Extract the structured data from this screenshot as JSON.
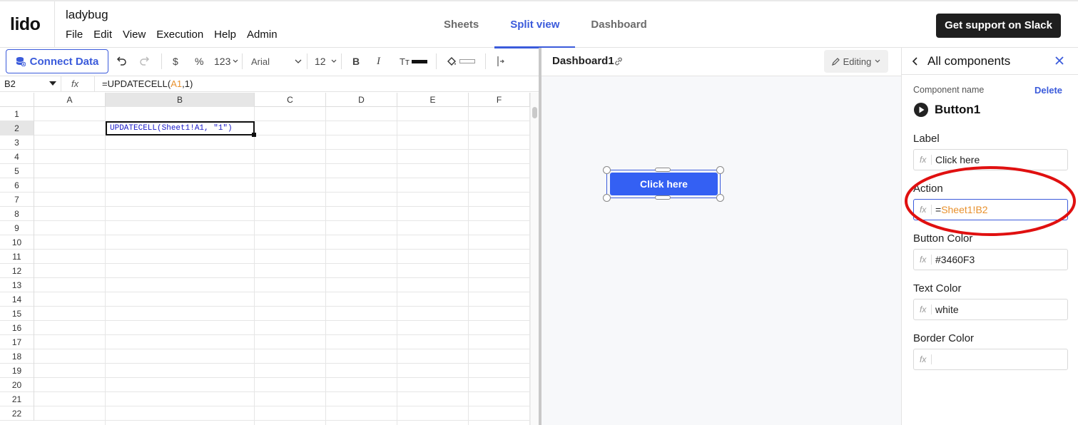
{
  "app": {
    "logo": "lido",
    "doc_title": "ladybug",
    "menu": [
      "File",
      "Edit",
      "View",
      "Execution",
      "Help",
      "Admin"
    ],
    "tabs": [
      {
        "label": "Sheets",
        "active": false
      },
      {
        "label": "Split view",
        "active": true
      },
      {
        "label": "Dashboard",
        "active": false
      }
    ],
    "support_button": "Get support on Slack"
  },
  "toolbar": {
    "connect_data": "Connect Data",
    "currency": "$",
    "percent": "%",
    "number_format": "123",
    "font": "Arial",
    "font_size": "12",
    "bold": "B",
    "italic": "I",
    "text_color": "Tт"
  },
  "formula_bar": {
    "cell_ref": "B2",
    "fx_label": "fx",
    "formula_prefix": "=UPDATECELL(",
    "formula_ref": "A1",
    "formula_suffix": ",1)"
  },
  "grid": {
    "columns": [
      "A",
      "B",
      "C",
      "D",
      "E",
      "F"
    ],
    "rows": [
      "1",
      "2",
      "3",
      "4",
      "5",
      "6",
      "7",
      "8",
      "9",
      "10",
      "11",
      "12",
      "13",
      "14",
      "15",
      "16",
      "17",
      "18",
      "19",
      "20",
      "21",
      "22"
    ],
    "selected_cell_text": "UPDATECELL(Sheet1!A1, \"1\")"
  },
  "dashboard": {
    "name": "Dashboard1",
    "editing_label": "Editing",
    "button_label": "Click here"
  },
  "properties": {
    "title": "All components",
    "component_name_label": "Component name",
    "delete_label": "Delete",
    "component_name": "Button1",
    "fx": "fx",
    "fields": [
      {
        "label": "Label",
        "prefix": "",
        "ref": "",
        "value": "Click here"
      },
      {
        "label": "Action",
        "prefix": "=",
        "ref": "Sheet1!B2",
        "value": ""
      },
      {
        "label": "Button Color",
        "prefix": "",
        "ref": "",
        "value": "#3460F3"
      },
      {
        "label": "Text Color",
        "prefix": "",
        "ref": "",
        "value": "white"
      },
      {
        "label": "Border Color",
        "prefix": "",
        "ref": "",
        "value": ""
      }
    ]
  },
  "colors": {
    "accent": "#3b5bdb",
    "button_color": "#3460F3",
    "formula_ref": "#e8912d",
    "annotation": "#e01010"
  },
  "icons": [
    "database-icon",
    "undo-icon",
    "redo-icon",
    "chevron-down-icon",
    "fill-color-icon",
    "column-width-icon",
    "link-icon",
    "pencil-icon",
    "back-arrow-icon",
    "close-icon",
    "play-circle-icon"
  ]
}
